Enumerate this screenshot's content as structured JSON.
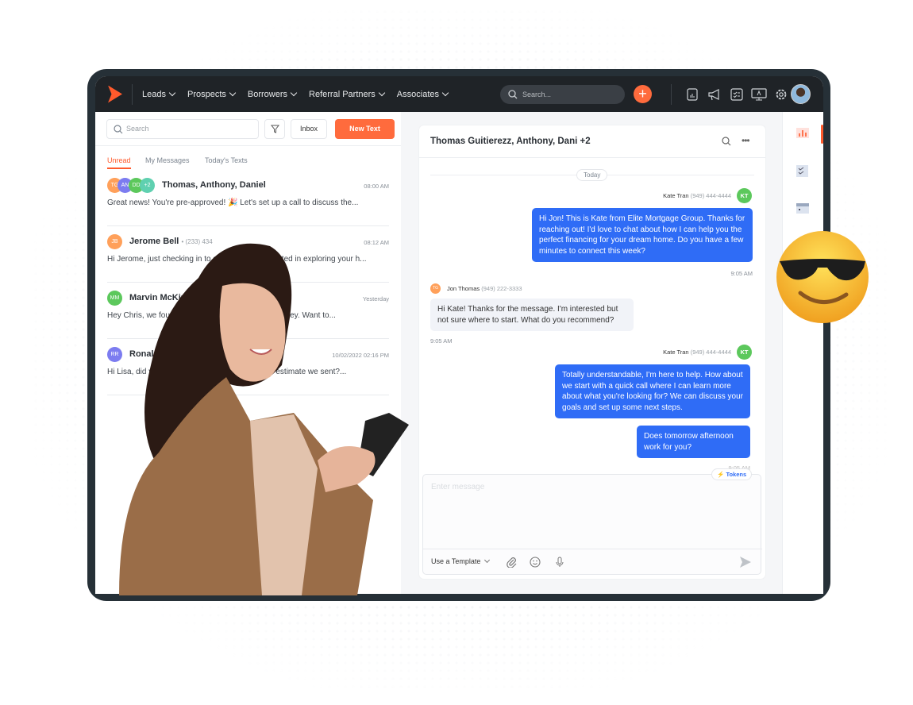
{
  "nav": {
    "items": [
      "Leads",
      "Prospects",
      "Borrowers",
      "Referral Partners",
      "Associates"
    ],
    "search_placeholder": "Search...",
    "icons": [
      "report-icon",
      "megaphone-icon",
      "checklist-icon",
      "presentation-icon",
      "gear-icon"
    ]
  },
  "colors": {
    "accent": "#ff6b3d",
    "outgoing": "#2f6cf6",
    "nav_bg": "#1f2327"
  },
  "left": {
    "search_placeholder": "Search",
    "inbox_label": "Inbox",
    "new_text_label": "New Text",
    "tabs": [
      "Unread",
      "My Messages",
      "Today's Texts"
    ],
    "conversations": [
      {
        "avatars": [
          "TG",
          "AN",
          "DD",
          "+2"
        ],
        "name": "Thomas, Anthony, Daniel",
        "phone": "",
        "time": "08:00 AM",
        "preview": "Great news! You're pre-approved! 🎉 Let's set up a call to discuss the..."
      },
      {
        "avatars": [
          "JB"
        ],
        "name": "Jerome Bell",
        "phone": "• (233) 434",
        "time": "08:12 AM",
        "preview": "Hi Jerome, just checking in to see if you're interested in exploring your h..."
      },
      {
        "avatars": [
          "MM"
        ],
        "name": "Marvin McKinney",
        "phone": "",
        "time": "Yesterday",
        "preview": "Hey Chris, we found a way that could save you money. Want to..."
      },
      {
        "avatars": [
          "RR"
        ],
        "name": "Ronald Richards",
        "phone": "",
        "time": "10/02/2022 02:16 PM",
        "preview": "Hi Lisa, did you get a chance to review the loan estimate we sent?..."
      }
    ]
  },
  "chat": {
    "title": "Thomas Guitierezz, Anthony, Dani +2",
    "date_divider": "Today",
    "messages": [
      {
        "sender": "Kate Tran",
        "phone": "(949) 444-4444",
        "initials": "KT",
        "text": "Hi Jon! This is Kate from Elite Mortgage Group. Thanks for reaching out! I'd love to chat about how I can help you the perfect financing for your dream home. Do you have a few minutes to connect this week?",
        "time": "9:05 AM"
      },
      {
        "sender": "Jon Thomas",
        "phone": "(949) 222-3333",
        "initials": "TG",
        "text": "Hi Kate! Thanks for the message. I'm interested but not sure where to start. What do you recommend?",
        "time": "9:05 AM"
      },
      {
        "sender": "Kate Tran",
        "phone": "(949) 444-4444",
        "initials": "KT",
        "text": "Totally understandable, I'm here to help. How about we start with a quick call where I can learn more about what you're looking for? We can discuss your goals and set up some next steps.",
        "time": ""
      },
      {
        "text": "Does tomorrow afternoon work for you?",
        "time": "9:05 AM"
      }
    ],
    "compose_placeholder": "Enter message",
    "tokens_label": "Tokens",
    "template_label": "Use a Template"
  }
}
